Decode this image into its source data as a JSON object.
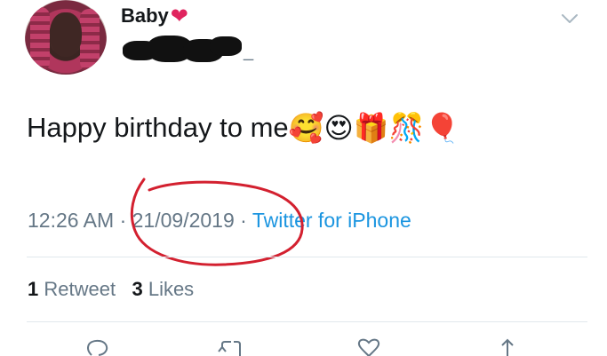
{
  "user": {
    "display_name": "Baby",
    "name_emoji": "❤",
    "handle_suffix": "_"
  },
  "tweet": {
    "text": "Happy birthday to me",
    "emojis": [
      "🥰",
      "😍",
      "🎁",
      "🎊",
      "🎈"
    ]
  },
  "meta": {
    "time": "12:26 AM",
    "separator1": "·",
    "date": "21/09/2019",
    "separator2": "·",
    "source": "Twitter for iPhone"
  },
  "stats": {
    "retweets_count": "1",
    "retweets_label": "Retweet",
    "likes_count": "3",
    "likes_label": "Likes"
  },
  "icons": {
    "more": "chevron-down-icon",
    "reply": "reply-icon",
    "retweet": "retweet-icon",
    "like": "like-icon",
    "share": "share-icon"
  },
  "colors": {
    "text": "#14171a",
    "secondary": "#657786",
    "link": "#1b95e0",
    "heart": "#e0245e",
    "annotation": "#d3202f"
  }
}
